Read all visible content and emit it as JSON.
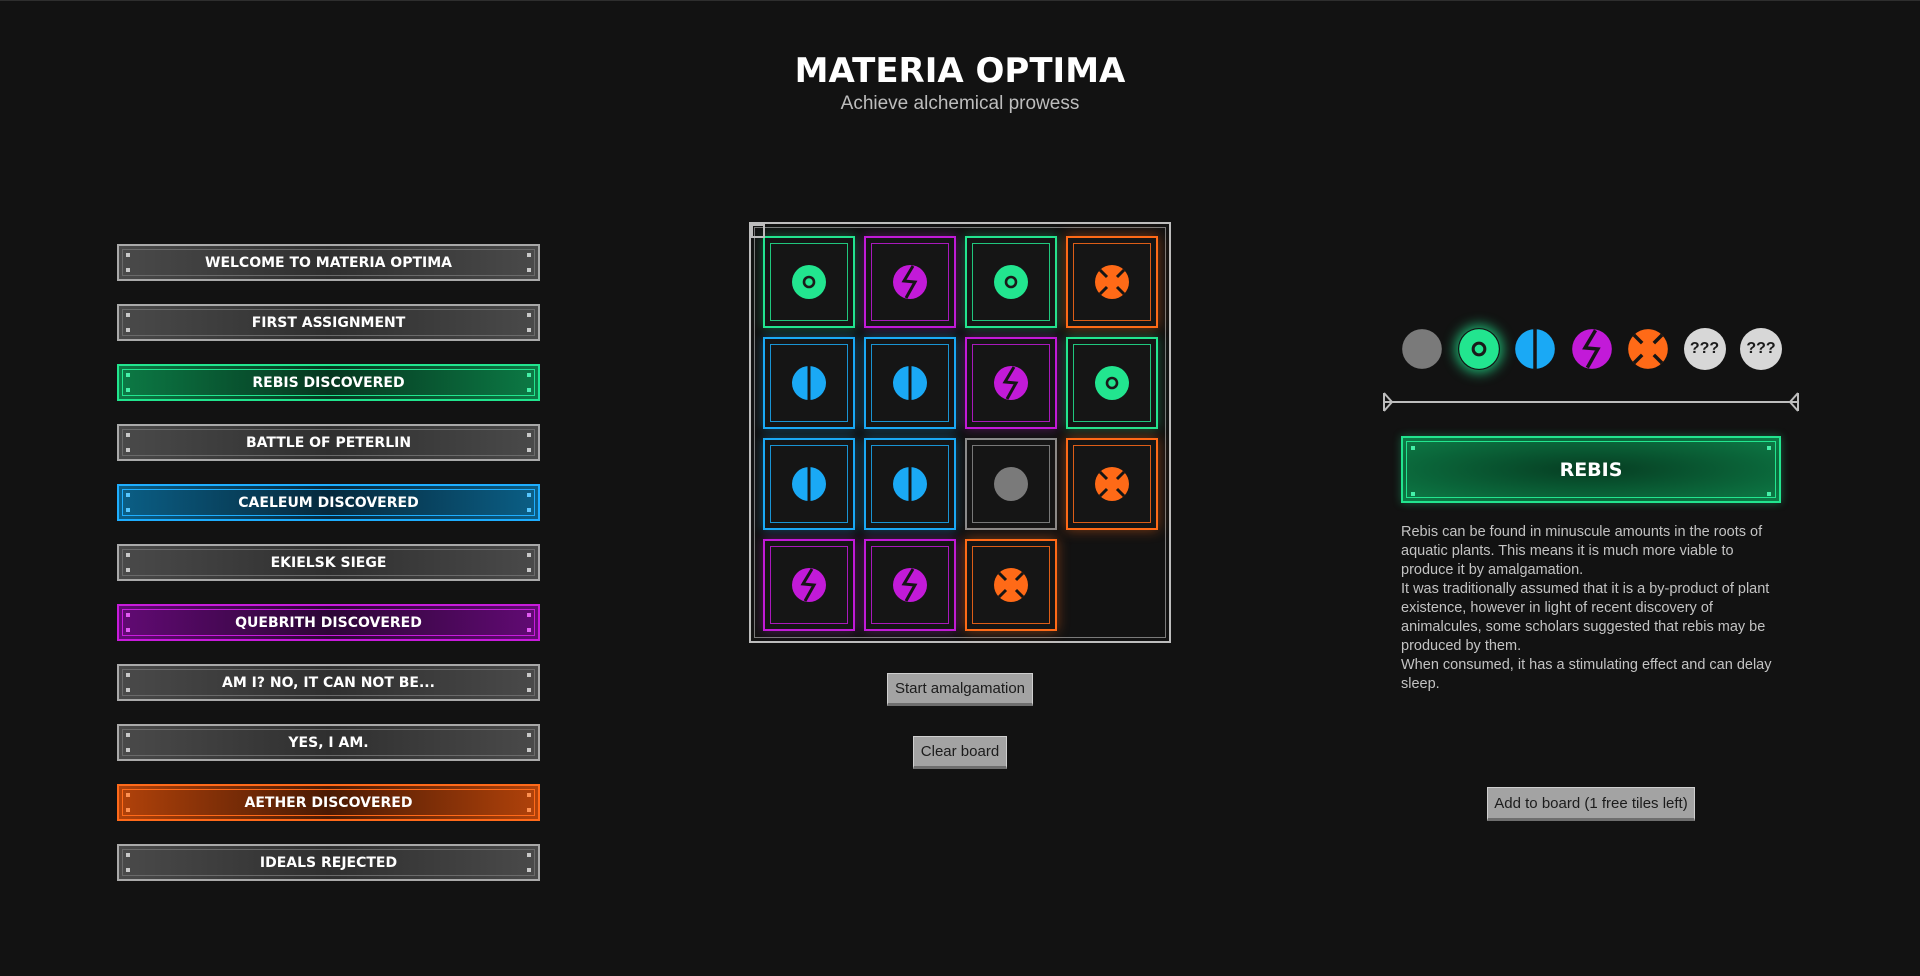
{
  "header": {
    "title": "MATERIA OPTIMA",
    "subtitle": "Achieve alchemical prowess"
  },
  "colors": {
    "grey": "#7a7a7a",
    "rebis_green": "#22e58f",
    "caeleum_blue": "#1aa9f5",
    "quebrith_purple": "#c21ad8",
    "aether_orange": "#ff6a17",
    "background": "#121212"
  },
  "chapters": [
    {
      "label": "WELCOME TO MATERIA OPTIMA",
      "style": "grey"
    },
    {
      "label": "FIRST ASSIGNMENT",
      "style": "grey"
    },
    {
      "label": "REBIS DISCOVERED",
      "style": "green"
    },
    {
      "label": "BATTLE OF PETERLIN",
      "style": "grey"
    },
    {
      "label": "CAELEUM DISCOVERED",
      "style": "blue"
    },
    {
      "label": "EKIELSK SIEGE",
      "style": "grey"
    },
    {
      "label": "QUEBRITH DISCOVERED",
      "style": "purple"
    },
    {
      "label": "AM I? NO, IT CAN NOT BE...",
      "style": "grey"
    },
    {
      "label": "YES, I AM.",
      "style": "grey"
    },
    {
      "label": "AETHER DISCOVERED",
      "style": "orange"
    },
    {
      "label": "IDEALS REJECTED",
      "style": "grey"
    }
  ],
  "board": {
    "rows": [
      [
        "rebis",
        "quebrith",
        "rebis",
        "aether"
      ],
      [
        "caeleum",
        "caeleum",
        "quebrith",
        "rebis"
      ],
      [
        "caeleum",
        "caeleum",
        "base",
        "aether"
      ],
      [
        "quebrith",
        "quebrith",
        "aether",
        null
      ]
    ],
    "start_label": "Start amalgamation",
    "clear_label": "Clear board"
  },
  "inventory": [
    {
      "id": "base",
      "icon": "grey-orb-icon"
    },
    {
      "id": "rebis",
      "icon": "rebis-orb-icon",
      "selected": true
    },
    {
      "id": "caeleum",
      "icon": "caeleum-orb-icon"
    },
    {
      "id": "quebrith",
      "icon": "quebrith-orb-icon"
    },
    {
      "id": "aether",
      "icon": "aether-orb-icon"
    },
    {
      "id": "unknown1",
      "label": "???"
    },
    {
      "id": "unknown2",
      "label": "???"
    }
  ],
  "details": {
    "name": "REBIS",
    "paragraphs": [
      "Rebis can be found in minuscule amounts in the roots of aquatic plants. This means  it is much more viable to produce it by amalgamation.",
      "It was traditionally assumed that it is a by-product of plant existence, however in light of recent discovery of animalcules, some scholars suggested that rebis may be produced by them.",
      "When consumed, it has a stimulating effect and can delay sleep."
    ],
    "add_label": "Add to board (1 free tiles left)"
  }
}
